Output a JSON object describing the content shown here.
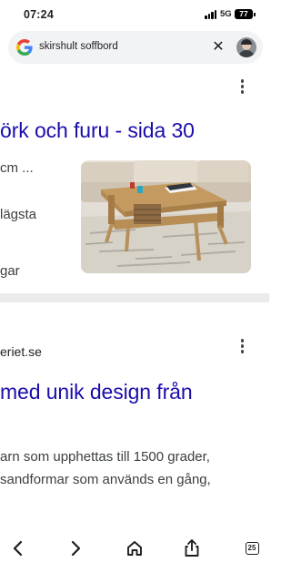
{
  "status_bar": {
    "time": "07:24",
    "network": "5G",
    "battery": "77"
  },
  "search": {
    "query": "skirshult soffbord",
    "clear_symbol": "✕"
  },
  "result1": {
    "title": "örk och furu - sida 30",
    "snippets": [
      "cm ...",
      "lägsta",
      "gar"
    ],
    "image_icon": "coffee-table-photo"
  },
  "result2": {
    "site": "eriet.se",
    "title": "med unik design från",
    "body_lines": [
      "arn som upphettas till 1500 grader,",
      "sandformar som används en gång,"
    ]
  },
  "toolbar": {
    "tabs_count": "25",
    "icons": [
      "back-icon",
      "forward-icon",
      "home-icon",
      "share-icon",
      "tabs-icon"
    ]
  },
  "colors": {
    "link_blue": "#1a0dab",
    "search_bg": "#f1f3f4",
    "divider": "#ebebeb"
  }
}
